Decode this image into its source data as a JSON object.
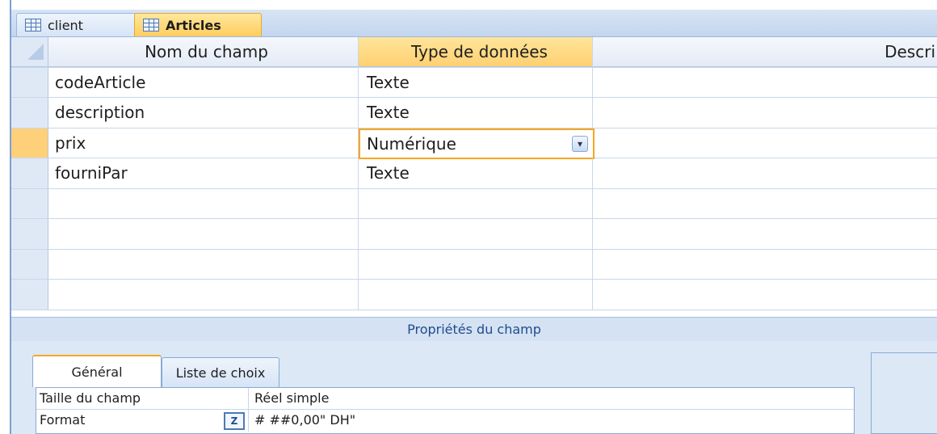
{
  "tabs": [
    {
      "label": "client",
      "active": false,
      "icon": "table-icon"
    },
    {
      "label": "Articles",
      "active": true,
      "icon": "table-icon"
    }
  ],
  "grid": {
    "headers": [
      "Nom du champ",
      "Type de données",
      "Descri"
    ],
    "rows": [
      {
        "name": "codeArticle",
        "type": "Texte",
        "description": ""
      },
      {
        "name": "description",
        "type": "Texte",
        "description": ""
      },
      {
        "name": "prix",
        "type": "Numérique",
        "description": ""
      },
      {
        "name": "fourniPar",
        "type": "Texte",
        "description": ""
      }
    ]
  },
  "properties": {
    "band_title": "Propriétés du champ",
    "tabs": [
      "Général",
      "Liste de choix"
    ],
    "rows": [
      {
        "label": "Taille du champ",
        "value": "Réel simple"
      },
      {
        "label": "Format",
        "value": "# ##0,00\" DH\""
      }
    ]
  },
  "colors": {
    "accent": "#f5a623",
    "header_blue": "#dfe9f6",
    "band": "#d5e2f3"
  }
}
